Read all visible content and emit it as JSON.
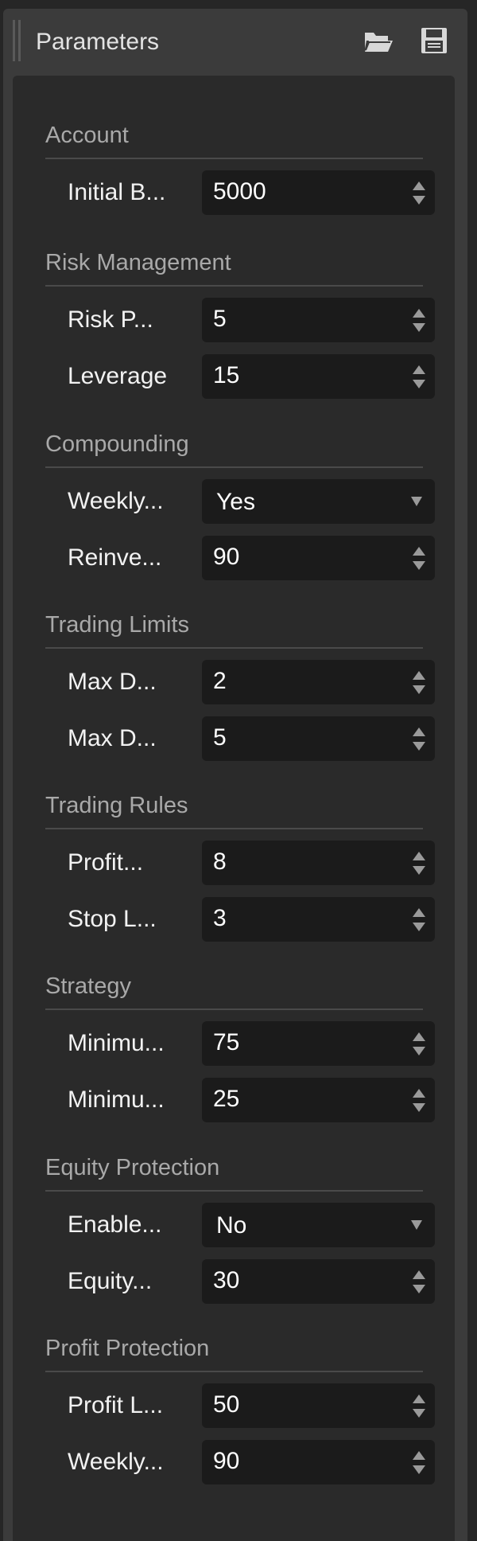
{
  "panel": {
    "title": "Parameters",
    "icons": {
      "open": "folder-open-icon",
      "save": "save-icon"
    }
  },
  "colors": {
    "background": "#262626",
    "panel_frame": "#3b3b3b",
    "content": "#2a2a2a",
    "field": "#1b1b1b",
    "group_title": "#a9a9a9",
    "label": "#f2f2f2"
  },
  "groups": [
    {
      "title": "Account",
      "params": [
        {
          "label": "Initial B...",
          "value": "5000",
          "control": "spinner"
        }
      ]
    },
    {
      "title": "Risk Management",
      "params": [
        {
          "label": "Risk P...",
          "value": "5",
          "control": "spinner"
        },
        {
          "label": "Leverage",
          "value": "15",
          "control": "spinner"
        }
      ]
    },
    {
      "title": "Compounding",
      "params": [
        {
          "label": "Weekly...",
          "value": "Yes",
          "control": "dropdown"
        },
        {
          "label": "Reinve...",
          "value": "90",
          "control": "spinner"
        }
      ]
    },
    {
      "title": "Trading Limits",
      "params": [
        {
          "label": "Max D...",
          "value": "2",
          "control": "spinner"
        },
        {
          "label": "Max D...",
          "value": "5",
          "control": "spinner"
        }
      ]
    },
    {
      "title": "Trading Rules",
      "params": [
        {
          "label": "Profit...",
          "value": "8",
          "control": "spinner"
        },
        {
          "label": "Stop L...",
          "value": "3",
          "control": "spinner"
        }
      ]
    },
    {
      "title": "Strategy",
      "params": [
        {
          "label": "Minimu...",
          "value": "75",
          "control": "spinner"
        },
        {
          "label": "Minimu...",
          "value": "25",
          "control": "spinner"
        }
      ]
    },
    {
      "title": "Equity Protection",
      "params": [
        {
          "label": "Enable...",
          "value": "No",
          "control": "dropdown"
        },
        {
          "label": "Equity...",
          "value": "30",
          "control": "spinner"
        }
      ]
    },
    {
      "title": "Profit Protection",
      "params": [
        {
          "label": "Profit L...",
          "value": "50",
          "control": "spinner"
        },
        {
          "label": "Weekly...",
          "value": "90",
          "control": "spinner"
        }
      ]
    }
  ]
}
